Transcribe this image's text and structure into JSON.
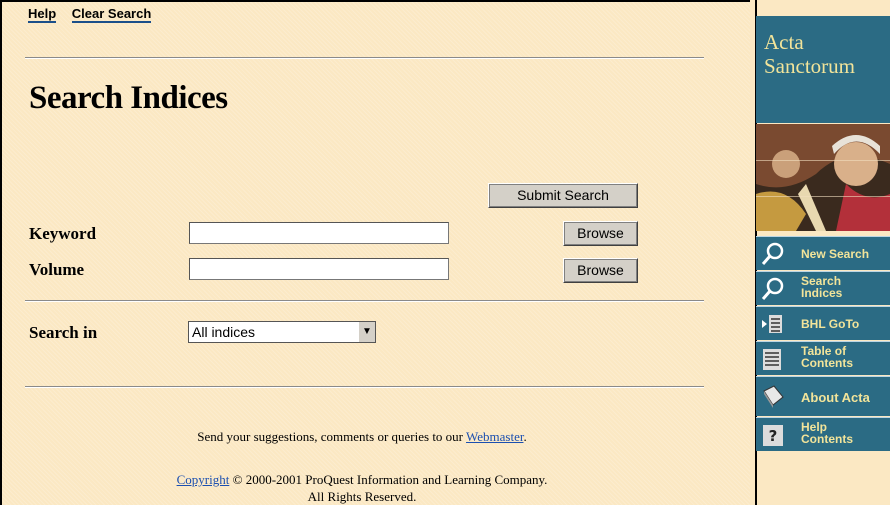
{
  "nav": {
    "help": "Help",
    "clear_search": "Clear Search"
  },
  "page_title": "Search Indices",
  "form": {
    "submit_label": "Submit Search",
    "keyword_label": "Keyword",
    "keyword_value": "",
    "keyword_browse": "Browse",
    "volume_label": "Volume",
    "volume_value": "",
    "volume_browse": "Browse",
    "search_in_label": "Search in",
    "search_in_value": "All indices"
  },
  "footer": {
    "suggest_text": "Send your suggestions, comments or queries to our",
    "webmaster": "Webmaster",
    "period": ".",
    "copyright_link": "Copyright",
    "copyright_text": "© 2000-2001 ProQuest Information and Learning Company.",
    "rights": "All Rights Reserved."
  },
  "sidebar": {
    "brand_line1": "Acta",
    "brand_line2": "Sanctorum",
    "items": [
      {
        "line1": "New Search",
        "line2": "",
        "icon": "magnifier-icon"
      },
      {
        "line1": "Search",
        "line2": "Indices",
        "icon": "magnifier-icon"
      },
      {
        "line1": "BHL GoTo",
        "line2": "",
        "icon": "list-arrow-icon"
      },
      {
        "line1": "Table of",
        "line2": "Contents",
        "icon": "list-icon"
      },
      {
        "line1": "About Acta",
        "line2": "",
        "icon": "book-icon"
      },
      {
        "line1": "Help",
        "line2": "Contents",
        "icon": "help-icon"
      }
    ]
  },
  "colors": {
    "page_bg": "#fbe8c3",
    "sidebar_bg": "#2b6b84",
    "sidebar_text": "#f2e49a",
    "link": "#1b4fb0"
  }
}
